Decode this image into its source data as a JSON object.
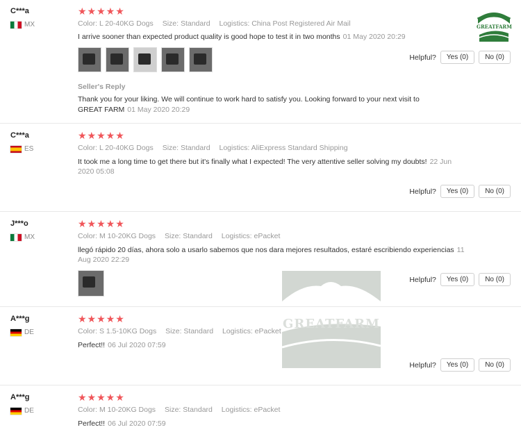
{
  "brand": {
    "logo_text": "GREATFARM"
  },
  "labels": {
    "helpful": "Helpful?",
    "seller_reply": "Seller's Reply",
    "color": "Color:",
    "size": "Size:",
    "logistics": "Logistics:"
  },
  "reviews": [
    {
      "user": "C***a",
      "country": "MX",
      "flag": "mx",
      "color": "L 20-40KG Dogs",
      "size": "Standard",
      "logistics": "China Post Registered Air Mail",
      "text": "I arrive sooner than expected product quality is good hope to test it in two months",
      "date": "01 May 2020 20:29",
      "yes": "Yes (0)",
      "no": "No (0)",
      "reply": "Thank you for your liking. We will continue to work hard to satisfy you. Looking forward to your next visit to GREAT FARM",
      "reply_date": "01 May 2020 20:29"
    },
    {
      "user": "C***a",
      "country": "ES",
      "flag": "es",
      "color": "L 20-40KG Dogs",
      "size": "Standard",
      "logistics": "AliExpress Standard Shipping",
      "text": "It took me a long time to get there but it's finally what I expected! The very attentive seller solving my doubts!",
      "date": "22 Jun 2020 05:08",
      "yes": "Yes (0)",
      "no": "No (0)"
    },
    {
      "user": "J***o",
      "country": "MX",
      "flag": "mx",
      "color": "M 10-20KG Dogs",
      "size": "Standard",
      "logistics": "ePacket",
      "text": "llegó rápido 20 días, ahora solo a usarlo sabemos que nos dara mejores resultados, estaré escribiendo experiencias",
      "date": "11 Aug 2020 22:29",
      "yes": "Yes (0)",
      "no": "No (0)"
    },
    {
      "user": "A***g",
      "country": "DE",
      "flag": "de",
      "color": "S 1.5-10KG Dogs",
      "size": "Standard",
      "logistics": "ePacket",
      "text": "Perfect!!",
      "date": "06 Jul 2020 07:59",
      "yes": "Yes (0)",
      "no": "No (0)"
    },
    {
      "user": "A***g",
      "country": "DE",
      "flag": "de",
      "color": "M 10-20KG Dogs",
      "size": "Standard",
      "logistics": "ePacket",
      "text": "Perfect!!",
      "date": "06 Jul 2020 07:59"
    }
  ],
  "stars": "★★★★★"
}
